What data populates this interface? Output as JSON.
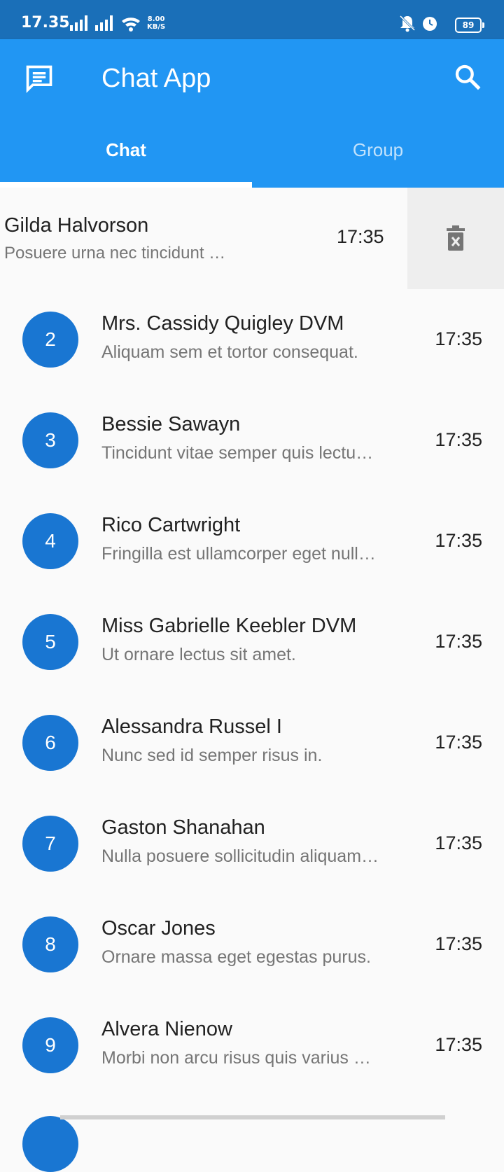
{
  "status_bar": {
    "time": "17.35",
    "net_speed_value": "8.00",
    "net_speed_unit": "KB/S",
    "battery": "89"
  },
  "app_bar": {
    "title": "Chat App",
    "background_color": "#2196f3",
    "leading_icon": "chat-bubble-icon",
    "trailing_icon": "search-icon"
  },
  "tabs": [
    {
      "label": "Chat",
      "selected": true
    },
    {
      "label": "Group",
      "selected": false
    }
  ],
  "swiped_chat": {
    "name": "Gilda Halvorson",
    "message": "Posuere urna nec tincidunt …",
    "time": "17:35",
    "action_icon": "delete-icon"
  },
  "chats": [
    {
      "avatar": "2",
      "name": "Mrs. Cassidy Quigley DVM",
      "message": "Aliquam sem et tortor consequat.",
      "time": "17:35"
    },
    {
      "avatar": "3",
      "name": "Bessie Sawayn",
      "message": "Tincidunt vitae semper quis lectu…",
      "time": "17:35"
    },
    {
      "avatar": "4",
      "name": "Rico Cartwright",
      "message": "Fringilla est ullamcorper eget null…",
      "time": "17:35"
    },
    {
      "avatar": "5",
      "name": "Miss Gabrielle Keebler DVM",
      "message": "Ut ornare lectus sit amet.",
      "time": "17:35"
    },
    {
      "avatar": "6",
      "name": "Alessandra Russel I",
      "message": "Nunc sed id semper risus in.",
      "time": "17:35"
    },
    {
      "avatar": "7",
      "name": "Gaston Shanahan",
      "message": "Nulla posuere sollicitudin aliquam…",
      "time": "17:35"
    },
    {
      "avatar": "8",
      "name": "Oscar Jones",
      "message": "Ornare massa eget egestas purus.",
      "time": "17:35"
    },
    {
      "avatar": "9",
      "name": "Alvera Nienow",
      "message": "Morbi non arcu risus quis varius …",
      "time": "17:35"
    }
  ],
  "colors": {
    "avatar": "#1976d2",
    "status_bar": "#1a6fb8"
  }
}
